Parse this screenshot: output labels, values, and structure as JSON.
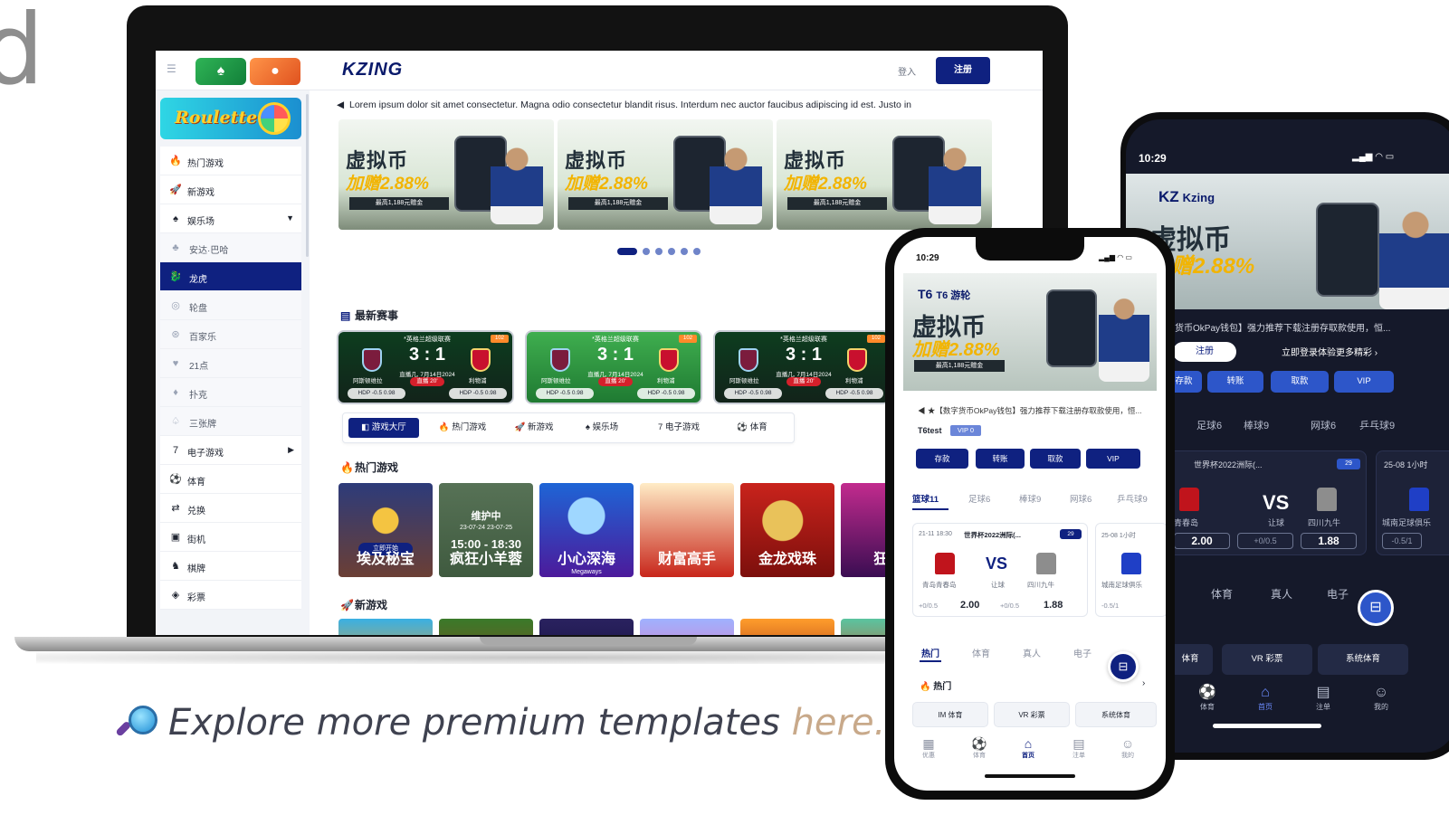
{
  "corner_letter": "d",
  "desktop": {
    "header": {
      "logo": "KZING",
      "login": "登入",
      "register": "注册"
    },
    "sidebar": {
      "banner": "Roulette",
      "items": [
        {
          "label": "热门游戏",
          "icon": "flame-icon",
          "glyph": "🔥"
        },
        {
          "label": "新游戏",
          "icon": "rocket-icon",
          "glyph": "🚀"
        },
        {
          "label": "娱乐场",
          "icon": "casino-icon",
          "glyph": "♠",
          "expanded": true
        },
        {
          "label": "安达·巴哈",
          "icon": "cards-icon",
          "glyph": "♣",
          "sub": true
        },
        {
          "label": "龙虎",
          "icon": "dragon-icon",
          "glyph": "🐉",
          "sub": true,
          "active": true
        },
        {
          "label": "轮盘",
          "icon": "roulette-icon",
          "glyph": "◎",
          "sub": true
        },
        {
          "label": "百家乐",
          "icon": "chip-icon",
          "glyph": "⊛",
          "sub": true
        },
        {
          "label": "21点",
          "icon": "blackjack-icon",
          "glyph": "♥",
          "sub": true
        },
        {
          "label": "扑克",
          "icon": "poker-icon",
          "glyph": "♦",
          "sub": true
        },
        {
          "label": "三张牌",
          "icon": "three-cards-icon",
          "glyph": "♤",
          "sub": true
        },
        {
          "label": "电子游戏",
          "icon": "slot-icon",
          "glyph": "7",
          "submenu": true
        },
        {
          "label": "体育",
          "icon": "football-icon",
          "glyph": "⚽"
        },
        {
          "label": "兑换",
          "icon": "exchange-icon",
          "glyph": "⇄"
        },
        {
          "label": "街机",
          "icon": "arcade-icon",
          "glyph": "▣"
        },
        {
          "label": "棋牌",
          "icon": "chess-icon",
          "glyph": "♞"
        },
        {
          "label": "彩票",
          "icon": "lottery-icon",
          "glyph": "◈"
        }
      ]
    },
    "marquee": "Lorem ipsum dolor sit amet consectetur. Magna odio consectetur blandit risus. Interdum nec auctor faucibus adipiscing id est. Justo in",
    "banners": [
      {
        "title": "虚拟币",
        "percent": "加赠2.88%",
        "sub": "最高1,188元赠金"
      },
      {
        "title": "虚拟币",
        "percent": "加赠2.88%",
        "sub": "最高1,188元赠金"
      },
      {
        "title": "虚拟币",
        "percent": "加赠2.88%",
        "sub": "最高1,188元赠金"
      }
    ],
    "carousel": {
      "total": 6,
      "active": 0
    },
    "matches_title": "最新赛事",
    "matches": [
      {
        "league": "*英格兰超级联赛",
        "score": "3 : 1",
        "date": "直播几, 7月14日2024",
        "live": "直播 20'",
        "home": "阿斯顿维拉",
        "away": "利物浦",
        "odd_home": "HDP -0.5   0.98",
        "odd_away": "HDP -0.5   0.98",
        "corner": "102",
        "theme": "dark"
      },
      {
        "league": "*英格兰超级联赛",
        "score": "3 : 1",
        "date": "直播几, 7月14日2024",
        "live": "直播 20'",
        "home": "阿斯顿维拉",
        "away": "利物浦",
        "odd_home": "HDP -0.5   0.98",
        "odd_away": "HDP -0.5   0.98",
        "corner": "102",
        "theme": "light"
      },
      {
        "league": "*英格兰超级联赛",
        "score": "3 : 1",
        "date": "直播几, 7月14日2024",
        "live": "直播 20'",
        "home": "阿斯顿维拉",
        "away": "利物浦",
        "odd_home": "HDP -0.5   0.98",
        "odd_away": "HDP -0.5   0.98",
        "corner": "102",
        "theme": "dark"
      }
    ],
    "category_tabs": [
      {
        "label": "游戏大厅",
        "active": true
      },
      {
        "label": "热门游戏"
      },
      {
        "label": "新游戏"
      },
      {
        "label": "娱乐场"
      },
      {
        "label": "电子游戏"
      },
      {
        "label": "体育"
      }
    ],
    "hot_title": "热门游戏",
    "hot_games": [
      {
        "label": "埃及秘宝",
        "start": "立即开始"
      },
      {
        "label": "疯狂小羊蓉",
        "maintenance": "维护中",
        "dates": "23-07-24     23-07-25",
        "time": "15:00 - 18:30"
      },
      {
        "label": "小心深海",
        "sub": "Megaways"
      },
      {
        "label": "财富高手"
      },
      {
        "label": "金龙戏珠"
      },
      {
        "label": "狂欢"
      }
    ],
    "new_title": "新游戏"
  },
  "phone_back": {
    "time": "10:29",
    "logo": "KZ",
    "logo_name": "Kzing",
    "hero_title": "虚拟币",
    "hero_percent": "加赠2.88%",
    "notice": "字货币OkPay钱包】强力推荐下载注册存取款使用，恒...",
    "register": "注册",
    "promo": "立即登录体验更多精彩",
    "buttons": [
      "存款",
      "转账",
      "取款",
      "VIP"
    ],
    "sports": [
      "足球6",
      "棒球9",
      "网球6",
      "乒乓球9"
    ],
    "match": {
      "title": "世界杯2022洲际(...",
      "badge": "29",
      "vs": "VS",
      "home": "青春岛",
      "draw": "让球",
      "away": "四川九牛",
      "odd_home": "2.00",
      "hdp": "+0/0.5",
      "odd_away": "1.88"
    },
    "match2": {
      "title": "25-08 1小时",
      "team": "城南足球俱乐",
      "hdp": "-0.5/1"
    },
    "tabs": [
      "体育",
      "真人",
      "电子"
    ],
    "chips": [
      "体育",
      "VR 彩票",
      "系统体育"
    ],
    "nav": [
      {
        "label": "体育",
        "icon": "football-icon",
        "glyph": "⚽"
      },
      {
        "label": "首页",
        "icon": "home-icon",
        "glyph": "⌂",
        "active": true
      },
      {
        "label": "注单",
        "icon": "bet-slip-icon",
        "glyph": "▤"
      },
      {
        "label": "我的",
        "icon": "user-icon",
        "glyph": "☺"
      }
    ]
  },
  "phone_front": {
    "time": "10:29",
    "logo": "T6",
    "logo_name": "T6 游轮",
    "hero_title": "虚拟币",
    "hero_percent": "加赠2.88%",
    "hero_sub": "最高1,188元赠金",
    "notice": "★【数字货币OkPay钱包】强力推荐下载注册存取款使用，恒...",
    "user": "T6test",
    "vip": "VIP 0",
    "buttons": [
      "存款",
      "转账",
      "取款",
      "VIP"
    ],
    "sports": [
      {
        "label": "篮球11",
        "active": true
      },
      {
        "label": "足球6"
      },
      {
        "label": "棒球9"
      },
      {
        "label": "网球6"
      },
      {
        "label": "乒乓球9"
      }
    ],
    "match": {
      "time": "21-11 18:30",
      "title": "世界杯2022洲际(...",
      "badge": "29",
      "vs": "VS",
      "home": "青岛青春岛",
      "draw": "让球",
      "away": "四川九牛",
      "hdp1": "+0/0.5",
      "odd1": "2.00",
      "hdp2": "+0/0.5",
      "odd2": "1.88"
    },
    "match2": {
      "time": "25-08 1小时",
      "team": "城南足球俱乐",
      "hdp": "-0.5/1"
    },
    "tabs": [
      {
        "label": "热门",
        "active": true
      },
      {
        "label": "体育"
      },
      {
        "label": "真人"
      },
      {
        "label": "电子"
      }
    ],
    "hot": "热门",
    "chips": [
      "IM 体育",
      "VR 彩票",
      "系统体育"
    ],
    "nav": [
      {
        "label": "优惠",
        "icon": "gift-icon",
        "glyph": "▦"
      },
      {
        "label": "体育",
        "icon": "football-icon",
        "glyph": "⚽"
      },
      {
        "label": "首页",
        "icon": "home-icon",
        "glyph": "⌂",
        "active": true
      },
      {
        "label": "注单",
        "icon": "bet-slip-icon",
        "glyph": "▤"
      },
      {
        "label": "我的",
        "icon": "user-icon",
        "glyph": "☺"
      }
    ]
  },
  "explore": {
    "text": "Explore more premium templates ",
    "link": "here."
  },
  "colors": {
    "brand_navy": "#0f2180",
    "accent_blue": "#2d56c9",
    "link": "#c8a98a"
  }
}
